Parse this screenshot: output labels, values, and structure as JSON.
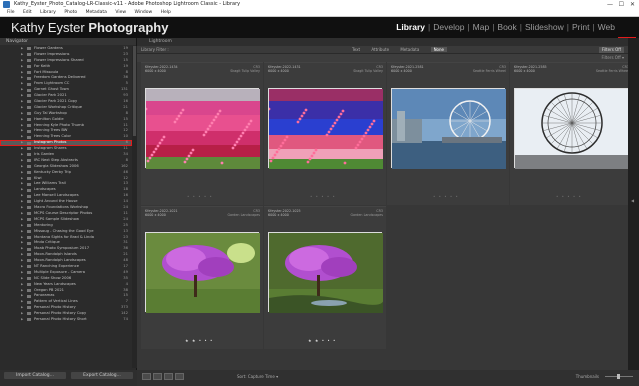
{
  "window": {
    "title": "Kathy_Eyster_Photo_Catalog-LR-Classic-v11 - Adobe Photoshop Lightroom Classic - Library",
    "controls": [
      "—",
      "☐",
      "✕"
    ]
  },
  "menu": [
    "File",
    "Edit",
    "Library",
    "Photo",
    "Metadata",
    "View",
    "Window",
    "Help"
  ],
  "identity": {
    "brand_first": "Kathy Eyster ",
    "brand_bold": "Photography",
    "modules": [
      "Library",
      "Develop",
      "Map",
      "Book",
      "Slideshow",
      "Print",
      "Web"
    ],
    "active_module": "Library",
    "highlight_color": "#e31b1b"
  },
  "left_panel": {
    "navigator": "Navigator",
    "folders": [
      {
        "name": "Flower Gardens",
        "count": "19"
      },
      {
        "name": "Flower Impressions",
        "count": "23"
      },
      {
        "name": "Flower Impressions Shared",
        "count": "15"
      },
      {
        "name": "For Keith",
        "count": "19"
      },
      {
        "name": "Fort Missoula",
        "count": "8"
      },
      {
        "name": "Freedom Gardens Delivered",
        "count": "36"
      },
      {
        "name": "From Lightroom CC",
        "count": "5"
      },
      {
        "name": "Garnet Ghost Town",
        "count": "131"
      },
      {
        "name": "Glacier Park 2021",
        "count": "93"
      },
      {
        "name": "Glacier Park 2021 Copy",
        "count": "16"
      },
      {
        "name": "Glacier Workshop Critique",
        "count": "21"
      },
      {
        "name": "Guy Tal Workshop",
        "count": "8"
      },
      {
        "name": "Hamilton Goldie",
        "count": "15"
      },
      {
        "name": "Henning Kyle Photo Thumb",
        "count": "11"
      },
      {
        "name": "Henning Trees BW",
        "count": "12"
      },
      {
        "name": "Henning Trees Color",
        "count": "10"
      },
      {
        "name": "Instagram Photos",
        "count": "6"
      },
      {
        "name": "Instagram Shares",
        "count": "11"
      },
      {
        "name": "Iris Garden",
        "count": "34"
      },
      {
        "name": "IRC Next Step Abstracts",
        "count": "8"
      },
      {
        "name": "Georgia Slideshow 2006",
        "count": "162"
      },
      {
        "name": "Kentucky Derby Trip",
        "count": "46"
      },
      {
        "name": "Kiwi",
        "count": "12"
      },
      {
        "name": "Lee Williams Trail",
        "count": "13"
      },
      {
        "name": "Landscapes",
        "count": "18"
      },
      {
        "name": "Lee Mansell Landscapes",
        "count": "16"
      },
      {
        "name": "Light Around the House",
        "count": "14"
      },
      {
        "name": "Macro Foundations Workshop",
        "count": "24"
      },
      {
        "name": "MCPS Course Descriptor Photos",
        "count": "11"
      },
      {
        "name": "MCPS Sample Slideshow",
        "count": "24"
      },
      {
        "name": "Mentoring",
        "count": "25"
      },
      {
        "name": "Missoug - Chasing the Good Eye",
        "count": "13"
      },
      {
        "name": "Montana Sights for Brad & Linda",
        "count": "23"
      },
      {
        "name": "Mnda Critique",
        "count": "31"
      },
      {
        "name": "Moab Photo Symposium 2017",
        "count": "36"
      },
      {
        "name": "Moon-Randolph Islands",
        "count": "21"
      },
      {
        "name": "Moon-Randolph Landscapes",
        "count": "48"
      },
      {
        "name": "NT Ranching Experience",
        "count": "17"
      },
      {
        "name": "Multiple Exposure - Camera",
        "count": "49"
      },
      {
        "name": "NC Slide Show 2006",
        "count": "35"
      },
      {
        "name": "New Years Landscapes",
        "count": "4"
      },
      {
        "name": "Oregon PB 2021",
        "count": "38"
      },
      {
        "name": "Panoramas",
        "count": "15"
      },
      {
        "name": "Pattern of Vertical Lines",
        "count": "7"
      },
      {
        "name": "Personal Photo History",
        "count": "373"
      },
      {
        "name": "Personal Photo History Copy",
        "count": "142"
      },
      {
        "name": "Personal Photo History Short",
        "count": "74"
      }
    ],
    "selected_index": 16,
    "import_button": "Import Catalog...",
    "export_button": "Export Catalog..."
  },
  "main": {
    "header": "Lightroom",
    "filter_label": "Library Filter :",
    "filter_options": [
      "Text",
      "Attribute",
      "Metadata",
      "None"
    ],
    "filter_active": "None",
    "filter_preset": "Filters Off",
    "filter_bar_right": "Filters Off ▾",
    "grid": [
      {
        "id": "Kfeyster-2022-1434",
        "ext": "CR3",
        "dims": "6000 x 4000",
        "folder": "Skagit Tulip Valley",
        "stars": "• • • • •",
        "rated": false,
        "scene": "tulips-pink"
      },
      {
        "id": "Kfeyster-2022-1431",
        "ext": "CR3",
        "dims": "6000 x 4000",
        "folder": "Skagit Tulip Valley",
        "stars": "• • • • •",
        "rated": false,
        "scene": "tulips-blue"
      },
      {
        "id": "Kfeyster-2021-2581",
        "ext": "CR3",
        "dims": "6000 x 4000",
        "folder": "Seattle Ferris Wheel",
        "stars": "• • • • •",
        "rated": false,
        "scene": "ferris-sky"
      },
      {
        "id": "Kfeyster-2021-2585",
        "ext": "CR3",
        "dims": "6000 x 4000",
        "folder": "Seattle Ferris Wheel",
        "stars": "• • • • •",
        "rated": false,
        "scene": "ferris-close"
      },
      {
        "id": "Kfeyster-2022-1021",
        "ext": "CR3",
        "dims": "6000 x 4000",
        "folder": "Garden Landscapes",
        "stars": "★ ★ • • •",
        "rated": true,
        "scene": "azalea-1"
      },
      {
        "id": "Kfeyster-2022-1025",
        "ext": "CR3",
        "dims": "6000 x 4000",
        "folder": "Garden Landscapes",
        "stars": "★ ★ • • •",
        "rated": true,
        "scene": "azalea-2"
      }
    ]
  },
  "toolbar": {
    "sort_label": "Sort:",
    "sort_value": "Capture Time ▾",
    "thumbs_label": "Thumbnails"
  }
}
